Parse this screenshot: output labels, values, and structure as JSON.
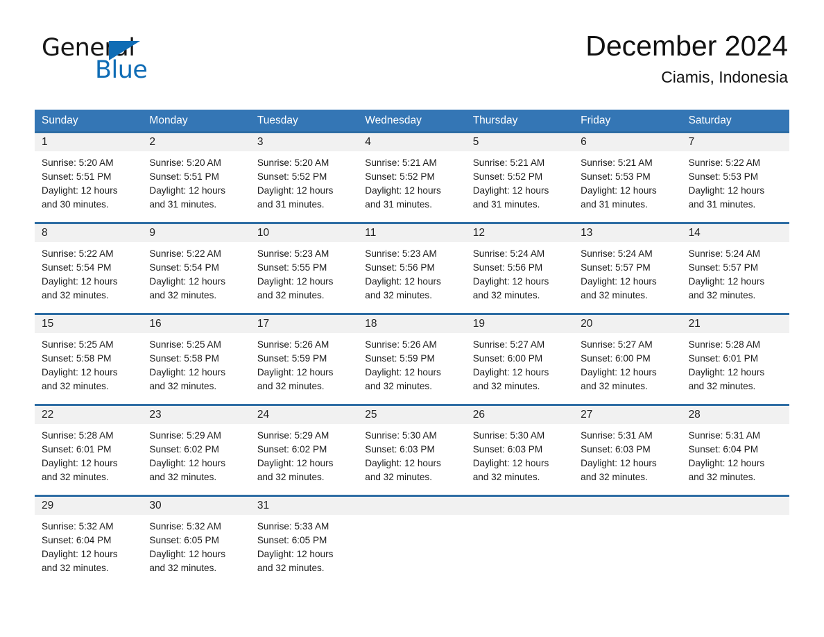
{
  "brand": {
    "name_part1": "General",
    "name_part2": "Blue",
    "triangle_color": "#0f6cb5"
  },
  "header": {
    "title": "December 2024",
    "location": "Ciamis, Indonesia"
  },
  "theme": {
    "header_blue": "#3476b5",
    "rule_blue": "#2e6da4",
    "daynum_band": "#f1f1f1",
    "text": "#1c1c1c"
  },
  "weekdays": [
    "Sunday",
    "Monday",
    "Tuesday",
    "Wednesday",
    "Thursday",
    "Friday",
    "Saturday"
  ],
  "weeks": [
    [
      {
        "day": "1",
        "sunrise": "Sunrise: 5:20 AM",
        "sunset": "Sunset: 5:51 PM",
        "daylight1": "Daylight: 12 hours",
        "daylight2": "and 30 minutes."
      },
      {
        "day": "2",
        "sunrise": "Sunrise: 5:20 AM",
        "sunset": "Sunset: 5:51 PM",
        "daylight1": "Daylight: 12 hours",
        "daylight2": "and 31 minutes."
      },
      {
        "day": "3",
        "sunrise": "Sunrise: 5:20 AM",
        "sunset": "Sunset: 5:52 PM",
        "daylight1": "Daylight: 12 hours",
        "daylight2": "and 31 minutes."
      },
      {
        "day": "4",
        "sunrise": "Sunrise: 5:21 AM",
        "sunset": "Sunset: 5:52 PM",
        "daylight1": "Daylight: 12 hours",
        "daylight2": "and 31 minutes."
      },
      {
        "day": "5",
        "sunrise": "Sunrise: 5:21 AM",
        "sunset": "Sunset: 5:52 PM",
        "daylight1": "Daylight: 12 hours",
        "daylight2": "and 31 minutes."
      },
      {
        "day": "6",
        "sunrise": "Sunrise: 5:21 AM",
        "sunset": "Sunset: 5:53 PM",
        "daylight1": "Daylight: 12 hours",
        "daylight2": "and 31 minutes."
      },
      {
        "day": "7",
        "sunrise": "Sunrise: 5:22 AM",
        "sunset": "Sunset: 5:53 PM",
        "daylight1": "Daylight: 12 hours",
        "daylight2": "and 31 minutes."
      }
    ],
    [
      {
        "day": "8",
        "sunrise": "Sunrise: 5:22 AM",
        "sunset": "Sunset: 5:54 PM",
        "daylight1": "Daylight: 12 hours",
        "daylight2": "and 32 minutes."
      },
      {
        "day": "9",
        "sunrise": "Sunrise: 5:22 AM",
        "sunset": "Sunset: 5:54 PM",
        "daylight1": "Daylight: 12 hours",
        "daylight2": "and 32 minutes."
      },
      {
        "day": "10",
        "sunrise": "Sunrise: 5:23 AM",
        "sunset": "Sunset: 5:55 PM",
        "daylight1": "Daylight: 12 hours",
        "daylight2": "and 32 minutes."
      },
      {
        "day": "11",
        "sunrise": "Sunrise: 5:23 AM",
        "sunset": "Sunset: 5:56 PM",
        "daylight1": "Daylight: 12 hours",
        "daylight2": "and 32 minutes."
      },
      {
        "day": "12",
        "sunrise": "Sunrise: 5:24 AM",
        "sunset": "Sunset: 5:56 PM",
        "daylight1": "Daylight: 12 hours",
        "daylight2": "and 32 minutes."
      },
      {
        "day": "13",
        "sunrise": "Sunrise: 5:24 AM",
        "sunset": "Sunset: 5:57 PM",
        "daylight1": "Daylight: 12 hours",
        "daylight2": "and 32 minutes."
      },
      {
        "day": "14",
        "sunrise": "Sunrise: 5:24 AM",
        "sunset": "Sunset: 5:57 PM",
        "daylight1": "Daylight: 12 hours",
        "daylight2": "and 32 minutes."
      }
    ],
    [
      {
        "day": "15",
        "sunrise": "Sunrise: 5:25 AM",
        "sunset": "Sunset: 5:58 PM",
        "daylight1": "Daylight: 12 hours",
        "daylight2": "and 32 minutes."
      },
      {
        "day": "16",
        "sunrise": "Sunrise: 5:25 AM",
        "sunset": "Sunset: 5:58 PM",
        "daylight1": "Daylight: 12 hours",
        "daylight2": "and 32 minutes."
      },
      {
        "day": "17",
        "sunrise": "Sunrise: 5:26 AM",
        "sunset": "Sunset: 5:59 PM",
        "daylight1": "Daylight: 12 hours",
        "daylight2": "and 32 minutes."
      },
      {
        "day": "18",
        "sunrise": "Sunrise: 5:26 AM",
        "sunset": "Sunset: 5:59 PM",
        "daylight1": "Daylight: 12 hours",
        "daylight2": "and 32 minutes."
      },
      {
        "day": "19",
        "sunrise": "Sunrise: 5:27 AM",
        "sunset": "Sunset: 6:00 PM",
        "daylight1": "Daylight: 12 hours",
        "daylight2": "and 32 minutes."
      },
      {
        "day": "20",
        "sunrise": "Sunrise: 5:27 AM",
        "sunset": "Sunset: 6:00 PM",
        "daylight1": "Daylight: 12 hours",
        "daylight2": "and 32 minutes."
      },
      {
        "day": "21",
        "sunrise": "Sunrise: 5:28 AM",
        "sunset": "Sunset: 6:01 PM",
        "daylight1": "Daylight: 12 hours",
        "daylight2": "and 32 minutes."
      }
    ],
    [
      {
        "day": "22",
        "sunrise": "Sunrise: 5:28 AM",
        "sunset": "Sunset: 6:01 PM",
        "daylight1": "Daylight: 12 hours",
        "daylight2": "and 32 minutes."
      },
      {
        "day": "23",
        "sunrise": "Sunrise: 5:29 AM",
        "sunset": "Sunset: 6:02 PM",
        "daylight1": "Daylight: 12 hours",
        "daylight2": "and 32 minutes."
      },
      {
        "day": "24",
        "sunrise": "Sunrise: 5:29 AM",
        "sunset": "Sunset: 6:02 PM",
        "daylight1": "Daylight: 12 hours",
        "daylight2": "and 32 minutes."
      },
      {
        "day": "25",
        "sunrise": "Sunrise: 5:30 AM",
        "sunset": "Sunset: 6:03 PM",
        "daylight1": "Daylight: 12 hours",
        "daylight2": "and 32 minutes."
      },
      {
        "day": "26",
        "sunrise": "Sunrise: 5:30 AM",
        "sunset": "Sunset: 6:03 PM",
        "daylight1": "Daylight: 12 hours",
        "daylight2": "and 32 minutes."
      },
      {
        "day": "27",
        "sunrise": "Sunrise: 5:31 AM",
        "sunset": "Sunset: 6:03 PM",
        "daylight1": "Daylight: 12 hours",
        "daylight2": "and 32 minutes."
      },
      {
        "day": "28",
        "sunrise": "Sunrise: 5:31 AM",
        "sunset": "Sunset: 6:04 PM",
        "daylight1": "Daylight: 12 hours",
        "daylight2": "and 32 minutes."
      }
    ],
    [
      {
        "day": "29",
        "sunrise": "Sunrise: 5:32 AM",
        "sunset": "Sunset: 6:04 PM",
        "daylight1": "Daylight: 12 hours",
        "daylight2": "and 32 minutes."
      },
      {
        "day": "30",
        "sunrise": "Sunrise: 5:32 AM",
        "sunset": "Sunset: 6:05 PM",
        "daylight1": "Daylight: 12 hours",
        "daylight2": "and 32 minutes."
      },
      {
        "day": "31",
        "sunrise": "Sunrise: 5:33 AM",
        "sunset": "Sunset: 6:05 PM",
        "daylight1": "Daylight: 12 hours",
        "daylight2": "and 32 minutes."
      },
      {
        "day": "",
        "sunrise": "",
        "sunset": "",
        "daylight1": "",
        "daylight2": ""
      },
      {
        "day": "",
        "sunrise": "",
        "sunset": "",
        "daylight1": "",
        "daylight2": ""
      },
      {
        "day": "",
        "sunrise": "",
        "sunset": "",
        "daylight1": "",
        "daylight2": ""
      },
      {
        "day": "",
        "sunrise": "",
        "sunset": "",
        "daylight1": "",
        "daylight2": ""
      }
    ]
  ]
}
